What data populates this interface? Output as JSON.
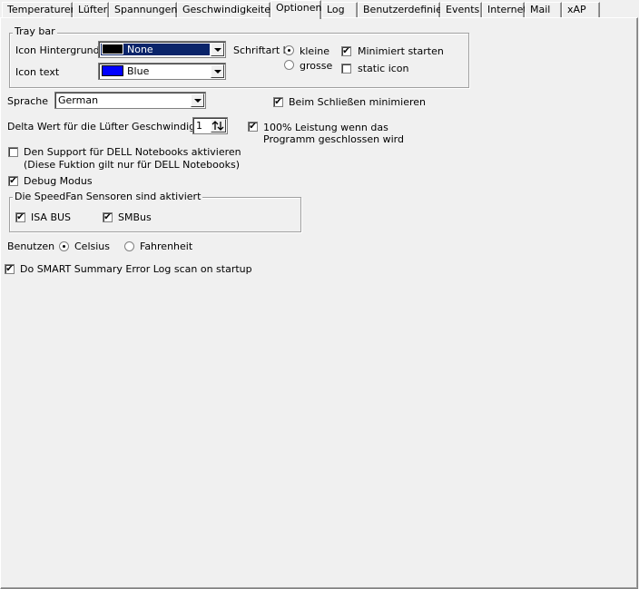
{
  "tabs": [
    "Temperaturen",
    "Lüfter",
    "Spannungen",
    "Geschwindigkeiten",
    "Optionen",
    "Log",
    "Benutzerdefiniert",
    "Events",
    "Internet",
    "Mail",
    "xAP"
  ],
  "active_tab": "Optionen",
  "traybar": {
    "legend": "Tray bar",
    "bg_label": "Icon Hintergrund",
    "bg_value": "None",
    "bg_color": "#000000",
    "text_label": "Icon text",
    "text_value": "Blue",
    "text_color": "#0000ff",
    "font_label": "Schriftart b",
    "font_small": "kleine",
    "font_large": "grosse",
    "start_minimized": "Minimiert starten",
    "static_icon": "static icon"
  },
  "language": {
    "label": "Sprache",
    "value": "German"
  },
  "close_minimize": "Beim Schließen minimieren",
  "delta": {
    "label": "Delta Wert für die Lüfter Geschwindigkeit",
    "value": "1"
  },
  "full_power": {
    "line1": "100% Leistung wenn das",
    "line2": "Programm geschlossen wird"
  },
  "dell": {
    "line1": "Den Support für DELL Notebooks aktivieren",
    "line2": "(Diese Fuktion gilt nur für DELL Notebooks)"
  },
  "debug": "Debug Modus",
  "sensors": {
    "legend": "Die SpeedFan Sensoren sind aktiviert",
    "isa": "ISA BUS",
    "smbus": "SMBus"
  },
  "units": {
    "label": "Benutzen",
    "celsius": "Celsius",
    "fahrenheit": "Fahrenheit"
  },
  "smart": "Do SMART Summary Error Log scan on startup",
  "checkmark": "✔"
}
